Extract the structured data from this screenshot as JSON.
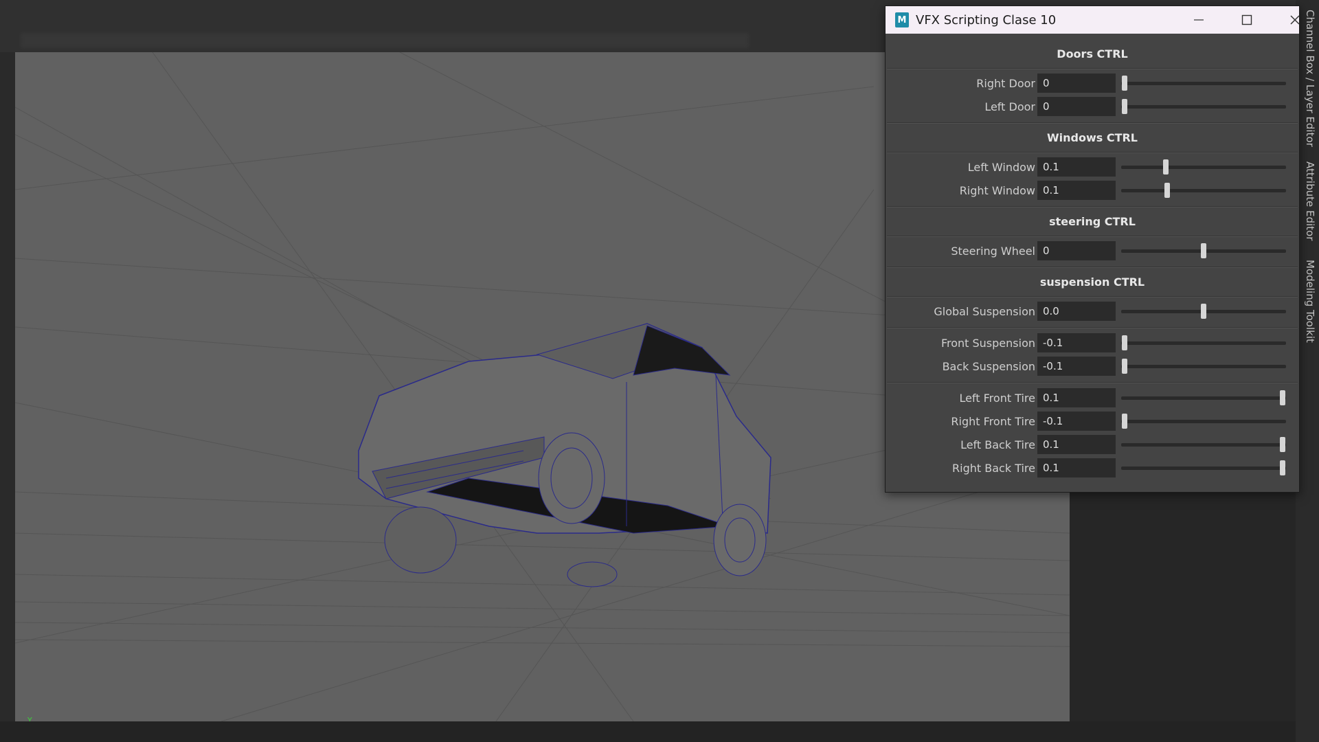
{
  "window": {
    "title": "VFX Scripting Clase 10",
    "icon_letter": "M",
    "minimize_icon": "minimize-icon",
    "maximize_icon": "maximize-icon",
    "close_icon": "close-icon"
  },
  "side_tabs": [
    "Channel Box / Layer Editor",
    "Attribute Editor",
    "Modeling Toolkit"
  ],
  "viewport": {
    "axis_label": "Y"
  },
  "sections": {
    "doors": "Doors CTRL",
    "windows": "Windows CTRL",
    "steering": "steering CTRL",
    "suspension": "suspension CTRL"
  },
  "controls": {
    "right_door": {
      "label": "Right Door",
      "value": "0",
      "slider": 0.02
    },
    "left_door": {
      "label": "Left Door",
      "value": "0",
      "slider": 0.02
    },
    "left_window": {
      "label": "Left Window",
      "value": "0.1",
      "slider": 0.27
    },
    "right_window": {
      "label": "Right Window",
      "value": "0.1",
      "slider": 0.28
    },
    "steering_wheel": {
      "label": "Steering Wheel",
      "value": "0",
      "slider": 0.5
    },
    "global_suspension": {
      "label": "Global Suspension",
      "value": "0.0",
      "slider": 0.5
    },
    "front_suspension": {
      "label": "Front Suspension",
      "value": "-0.1",
      "slider": 0.02
    },
    "back_suspension": {
      "label": "Back Suspension",
      "value": "-0.1",
      "slider": 0.02
    },
    "left_front_tire": {
      "label": "Left Front Tire",
      "value": "0.1",
      "slider": 0.98
    },
    "right_front_tire": {
      "label": "Right Front Tire",
      "value": "-0.1",
      "slider": 0.02
    },
    "left_back_tire": {
      "label": "Left Back Tire",
      "value": "0.1",
      "slider": 0.98
    },
    "right_back_tire": {
      "label": "Right Back Tire",
      "value": "0.1",
      "slider": 0.98
    }
  }
}
